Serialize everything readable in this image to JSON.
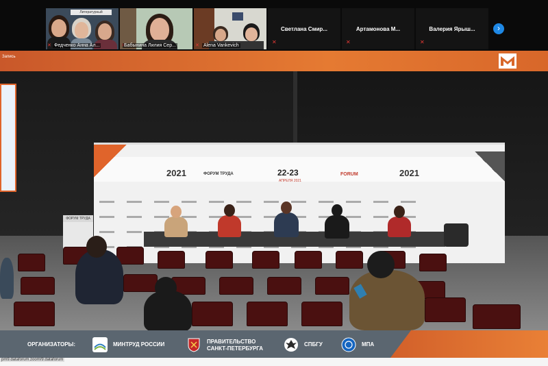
{
  "participants": {
    "tile1_caption": "Федченко Анна Ал...",
    "tile2_caption": "Бабынина Лилия Сер...",
    "tile3_caption": "Alena Vankevich",
    "tile1_sign": "Литературный",
    "name_tiles": [
      {
        "name": "Светлана Смир..."
      },
      {
        "name": "Артамонова М..."
      },
      {
        "name": "Валерия Ярыш..."
      }
    ],
    "next_icon": "chevron-right-icon"
  },
  "recording": {
    "label": "Запись"
  },
  "stage": {
    "year_left": "2021",
    "year_right": "2021",
    "dates": "22-23",
    "month": "АПРЕЛЯ 2021",
    "forum_name_left": "ФОРУМ ТРУДА",
    "forum_name_right": "FORUM",
    "lectern_label": "ФОРУМ ТРУДА"
  },
  "banner": {
    "organizers_label": "ОРГАНИЗАТОРЫ:",
    "org1": "МИНТРУД РОССИИ",
    "org2_line1": "ПРАВИТЕЛЬСТВО",
    "org2_line2": "САНКТ-ПЕТЕРБУРГА",
    "org3": "СПБГУ",
    "org4": "МПА",
    "url": "pm9.dataforum.zoom/9.dataforum"
  },
  "colors": {
    "accent": "#e0642b",
    "banner_grey": "#5b6670",
    "zoom_blue": "#1e88e5",
    "mic_red": "#e53935"
  }
}
